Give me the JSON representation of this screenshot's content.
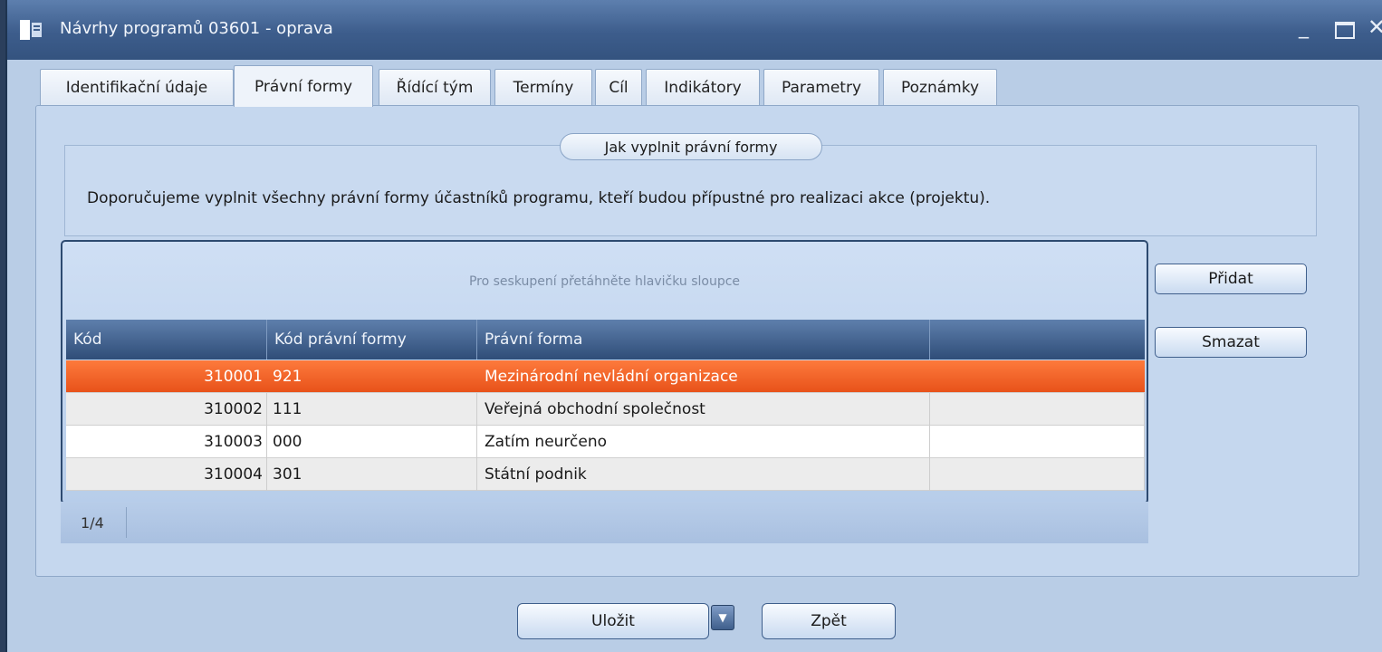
{
  "window": {
    "title": "Návrhy programů 03601 - oprava"
  },
  "tabs": [
    {
      "label": "Identifikační údaje"
    },
    {
      "label": "Právní formy"
    },
    {
      "label": "Řídící tým"
    },
    {
      "label": "Termíny"
    },
    {
      "label": "Cíl"
    },
    {
      "label": "Indikátory"
    },
    {
      "label": "Parametry"
    },
    {
      "label": "Poznámky"
    }
  ],
  "active_tab": "Právní formy",
  "info": {
    "legend": "Jak vyplnit právní formy",
    "text": "Doporučujeme vyplnit všechny právní formy účastníků programu, kteří budou přípustné pro realizaci akce (projektu)."
  },
  "grid": {
    "group_hint": "Pro seskupení přetáhněte hlavičku sloupce",
    "columns": [
      "Kód",
      "Kód právní formy",
      "Právní forma",
      ""
    ],
    "rows": [
      {
        "kod": "310001",
        "kod_pf": "921",
        "forma": "Mezinárodní nevládní organizace",
        "selected": true
      },
      {
        "kod": "310002",
        "kod_pf": "111",
        "forma": "Veřejná obchodní společnost",
        "selected": false
      },
      {
        "kod": "310003",
        "kod_pf": "000",
        "forma": "Zatím neurčeno",
        "selected": false
      },
      {
        "kod": "310004",
        "kod_pf": "301",
        "forma": "Státní podnik",
        "selected": false
      }
    ],
    "pager": "1/4"
  },
  "side_buttons": {
    "add": "Přidat",
    "delete": "Smazat"
  },
  "footer": {
    "save": "Uložit",
    "back": "Zpět"
  },
  "colors": {
    "selected_row": "#f26a2c",
    "header": "#3f5f8c",
    "titlebar": "#4a6a99"
  }
}
